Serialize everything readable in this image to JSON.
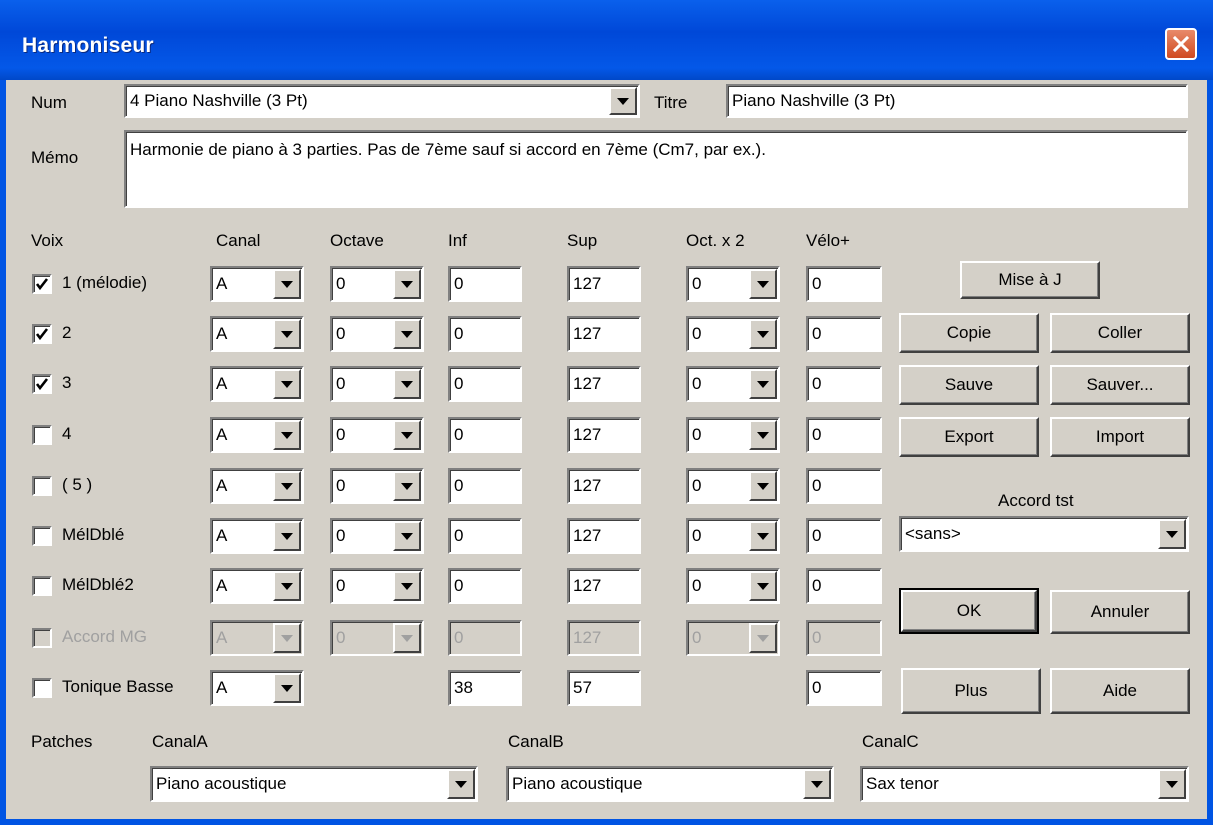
{
  "window": {
    "title": "Harmoniseur"
  },
  "header": {
    "num_label": "Num",
    "num_value": "4 Piano Nashville (3 Pt)",
    "titre_label": "Titre",
    "titre_value": "Piano Nashville (3 Pt)",
    "memo_label": "Mémo",
    "memo_value": "Harmonie de piano à 3 parties. Pas de 7ème sauf si accord en 7ème (Cm7, par ex.)."
  },
  "columns": {
    "voix": "Voix",
    "canal": "Canal",
    "octave": "Octave",
    "inf": "Inf",
    "sup": "Sup",
    "oct_x2": "Oct. x 2",
    "velo": "Vélo+"
  },
  "voices": [
    {
      "label": "1 (mélodie)",
      "checked": true,
      "canal": "A",
      "octave": "0",
      "inf": "0",
      "sup": "127",
      "oct2": "0",
      "velo": "0"
    },
    {
      "label": "2",
      "checked": true,
      "canal": "A",
      "octave": "0",
      "inf": "0",
      "sup": "127",
      "oct2": "0",
      "velo": "0"
    },
    {
      "label": "3",
      "checked": true,
      "canal": "A",
      "octave": "0",
      "inf": "0",
      "sup": "127",
      "oct2": "0",
      "velo": "0"
    },
    {
      "label": "4",
      "checked": false,
      "canal": "A",
      "octave": "0",
      "inf": "0",
      "sup": "127",
      "oct2": "0",
      "velo": "0"
    },
    {
      "label": "( 5 )",
      "checked": false,
      "canal": "A",
      "octave": "0",
      "inf": "0",
      "sup": "127",
      "oct2": "0",
      "velo": "0"
    },
    {
      "label": "MélDblé",
      "checked": false,
      "canal": "A",
      "octave": "0",
      "inf": "0",
      "sup": "127",
      "oct2": "0",
      "velo": "0"
    },
    {
      "label": "MélDblé2",
      "checked": false,
      "canal": "A",
      "octave": "0",
      "inf": "0",
      "sup": "127",
      "oct2": "0",
      "velo": "0"
    },
    {
      "label": "Accord MG",
      "checked": false,
      "disabled": true,
      "canal": "A",
      "octave": "0",
      "inf": "0",
      "sup": "127",
      "oct2": "0",
      "velo": "0"
    },
    {
      "label": "Tonique Basse",
      "checked": false,
      "canal": "A",
      "inf": "38",
      "sup": "57",
      "velo": "0"
    }
  ],
  "buttons": {
    "mise_a_j": "Mise à J",
    "copie": "Copie",
    "coller": "Coller",
    "sauve": "Sauve",
    "sauver": "Sauver...",
    "export": "Export",
    "import": "Import",
    "ok": "OK",
    "annuler": "Annuler",
    "plus": "Plus",
    "aide": "Aide"
  },
  "accord_tst": {
    "label": "Accord tst",
    "value": "<sans>"
  },
  "patches": {
    "label": "Patches",
    "canal_a_label": "CanalA",
    "canal_a_value": "Piano acoustique",
    "canal_b_label": "CanalB",
    "canal_b_value": "Piano acoustique",
    "canal_c_label": "CanalC",
    "canal_c_value": "Sax tenor"
  },
  "colors": {
    "titlebar": "#0054e3",
    "dialog_bg": "#d4d0c8",
    "close_button": "#d04a20"
  }
}
